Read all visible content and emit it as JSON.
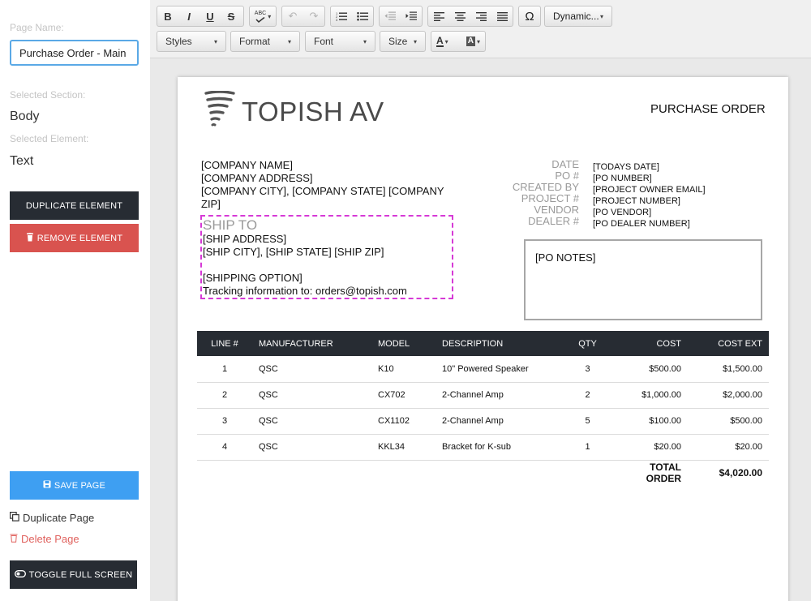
{
  "sidebar": {
    "page_name_label": "Page Name:",
    "page_name_value": "Purchase Order - Main",
    "selected_section_label": "Selected Section:",
    "selected_section_value": "Body",
    "selected_element_label": "Selected Element:",
    "selected_element_value": "Text",
    "duplicate_element": "DUPLICATE ELEMENT",
    "remove_element": "REMOVE ELEMENT",
    "save_page": "SAVE PAGE",
    "duplicate_page": "Duplicate Page",
    "delete_page": "Delete Page",
    "toggle_full_screen": "TOGGLE FULL SCREEN"
  },
  "toolbar": {
    "bold": "B",
    "italic": "I",
    "underline": "U",
    "strike": "S",
    "spellcheck": "ABC",
    "special_char": "Ω",
    "dynamic": "Dynamic...",
    "styles": "Styles",
    "format": "Format",
    "font": "Font",
    "size": "Size",
    "text_color": "A",
    "bg_color": "A"
  },
  "doc": {
    "logo_text": "TOPISH AV",
    "title": "PURCHASE ORDER",
    "company": {
      "name": "[COMPANY NAME]",
      "address": "[COMPANY ADDRESS]",
      "city_state_zip": "[COMPANY CITY], [COMPANY STATE] [COMPANY ZIP]"
    },
    "ship": {
      "heading": "SHIP TO",
      "address": "[SHIP ADDRESS]",
      "city_state_zip": "[SHIP CITY], [SHIP STATE] [SHIP ZIP]",
      "option": "[SHIPPING OPTION]",
      "tracking": "Tracking information to: orders@topish.com"
    },
    "meta": {
      "labels": [
        "DATE",
        "PO #",
        "CREATED BY",
        "PROJECT #",
        "VENDOR",
        "DEALER #"
      ],
      "values": [
        "[TODAYS DATE]",
        "[PO NUMBER]",
        "[PROJECT OWNER EMAIL]",
        "[PROJECT NUMBER]",
        "[PO VENDOR]",
        "[PO DEALER NUMBER]"
      ]
    },
    "notes": "[PO NOTES]",
    "table": {
      "headers": [
        "LINE #",
        "MANUFACTURER",
        "MODEL",
        "DESCRIPTION",
        "QTY",
        "COST",
        "COST EXT"
      ],
      "rows": [
        [
          "1",
          "QSC",
          "K10",
          "10\" Powered Speaker",
          "3",
          "$500.00",
          "$1,500.00"
        ],
        [
          "2",
          "QSC",
          "CX702",
          "2-Channel Amp",
          "2",
          "$1,000.00",
          "$2,000.00"
        ],
        [
          "3",
          "QSC",
          "CX1102",
          "2-Channel Amp",
          "5",
          "$100.00",
          "$500.00"
        ],
        [
          "4",
          "QSC",
          "KKL34",
          "Bracket for K-sub",
          "1",
          "$20.00",
          "$20.00"
        ]
      ],
      "total_label": "TOTAL ORDER",
      "total_value": "$4,020.00"
    }
  },
  "colors": {
    "dark_button": "#272c33",
    "remove_button": "#d9534f",
    "save_button": "#3e9ff2",
    "selection_outline": "#d63ad6"
  }
}
